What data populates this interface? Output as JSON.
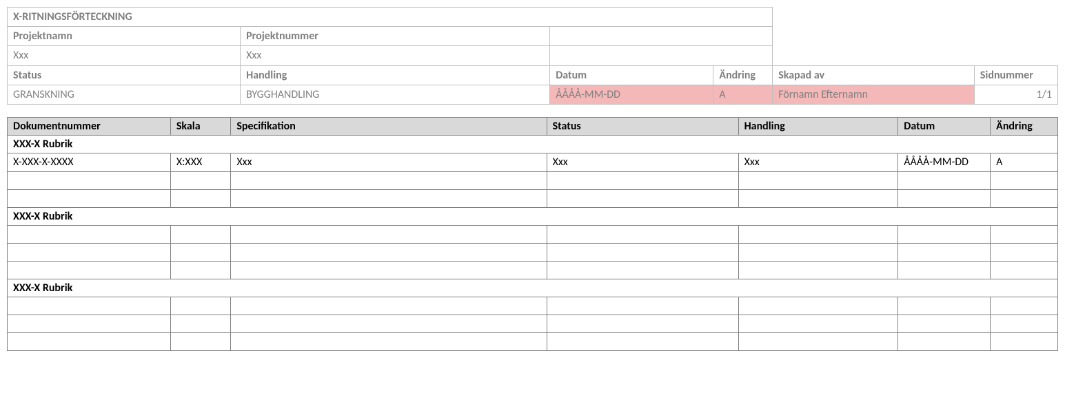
{
  "header": {
    "title": "X-RITNINGSFÖRTECKNING",
    "labels": {
      "projektnamn": "Projektnamn",
      "projektnummer": "Projektnummer",
      "status": "Status",
      "handling": "Handling",
      "datum": "Datum",
      "andring": "Ändring",
      "skapad_av": "Skapad av",
      "sidnummer": "Sidnummer"
    },
    "values": {
      "projektnamn": "Xxx",
      "projektnummer": "Xxx",
      "status": "GRANSKNING",
      "handling": "BYGGHANDLING",
      "datum": "ÅÅÅÅ-MM-DD",
      "andring": "A",
      "skapad_av": "Förnamn Efternamn",
      "sidnummer": "1/1"
    }
  },
  "table": {
    "columns": {
      "dokumentnummer": "Dokumentnummer",
      "skala": "Skala",
      "specifikation": "Specifikation",
      "status": "Status",
      "handling": "Handling",
      "datum": "Datum",
      "andring": "Ändring"
    },
    "groups": [
      {
        "rubrik": "XXX-X Rubrik",
        "rows": [
          {
            "dokumentnummer": "X-XXX-X-XXXX",
            "skala": "X:XXX",
            "specifikation": "Xxx",
            "status": "Xxx",
            "handling": "Xxx",
            "datum": "ÅÅÅÅ-MM-DD",
            "andring": "A",
            "highlight": true
          },
          {
            "dokumentnummer": "",
            "skala": "",
            "specifikation": "",
            "status": "",
            "handling": "",
            "datum": "",
            "andring": ""
          },
          {
            "dokumentnummer": "",
            "skala": "",
            "specifikation": "",
            "status": "",
            "handling": "",
            "datum": "",
            "andring": ""
          }
        ]
      },
      {
        "rubrik": "XXX-X Rubrik",
        "rows": [
          {
            "dokumentnummer": "",
            "skala": "",
            "specifikation": "",
            "status": "",
            "handling": "",
            "datum": "",
            "andring": ""
          },
          {
            "dokumentnummer": "",
            "skala": "",
            "specifikation": "",
            "status": "",
            "handling": "",
            "datum": "",
            "andring": ""
          },
          {
            "dokumentnummer": "",
            "skala": "",
            "specifikation": "",
            "status": "",
            "handling": "",
            "datum": "",
            "andring": ""
          }
        ]
      },
      {
        "rubrik": "XXX-X Rubrik",
        "rows": [
          {
            "dokumentnummer": "",
            "skala": "",
            "specifikation": "",
            "status": "",
            "handling": "",
            "datum": "",
            "andring": ""
          },
          {
            "dokumentnummer": "",
            "skala": "",
            "specifikation": "",
            "status": "",
            "handling": "",
            "datum": "",
            "andring": ""
          },
          {
            "dokumentnummer": "",
            "skala": "",
            "specifikation": "",
            "status": "",
            "handling": "",
            "datum": "",
            "andring": ""
          }
        ]
      }
    ]
  }
}
